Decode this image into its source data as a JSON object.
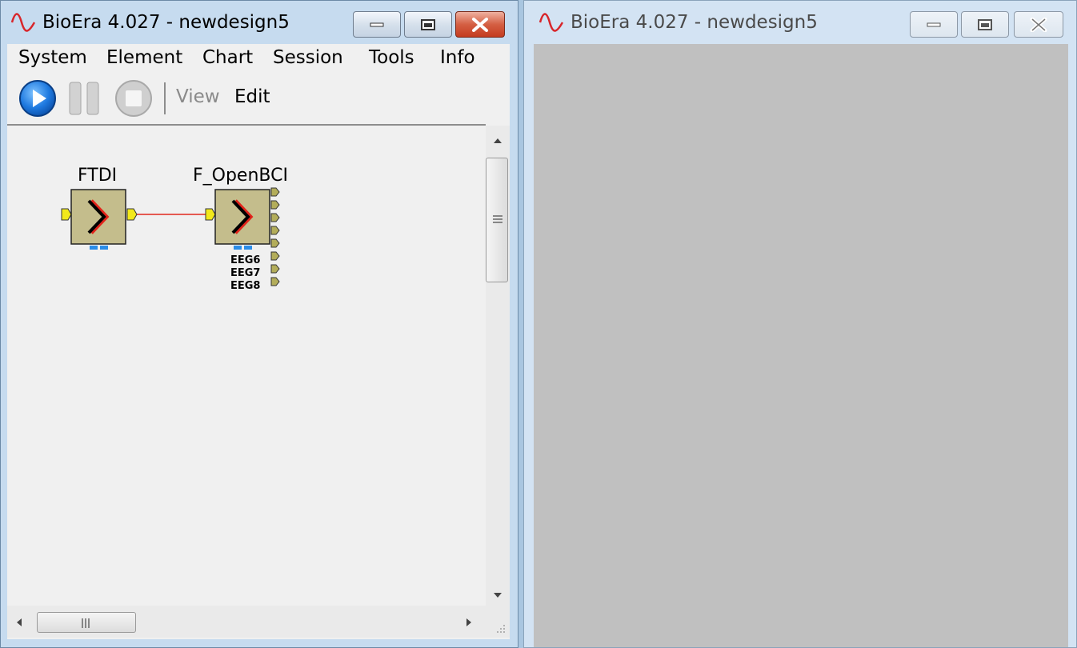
{
  "left_window": {
    "title": "BioEra 4.027 - newdesign5",
    "menu": [
      "System",
      "Element",
      "Chart",
      "Session",
      "Tools",
      "Info"
    ],
    "toolbar": {
      "play": "play-icon",
      "pause": "pause-icon",
      "stop": "stop-icon",
      "view_label": "View",
      "edit_label": "Edit"
    },
    "design": {
      "elements": [
        {
          "label": "FTDI"
        },
        {
          "label": "F_OpenBCI",
          "ports": [
            "EEG6",
            "EEG7",
            "EEG8"
          ]
        }
      ]
    }
  },
  "right_window": {
    "title": "BioEra 4.027 - newdesign5"
  },
  "colors": {
    "element_fill": "#c4bd8c",
    "connection": "#e0281e",
    "port_in": "#f2e81a",
    "port_out": "#b3ad5a",
    "gray_area": "#c0c0c0"
  }
}
